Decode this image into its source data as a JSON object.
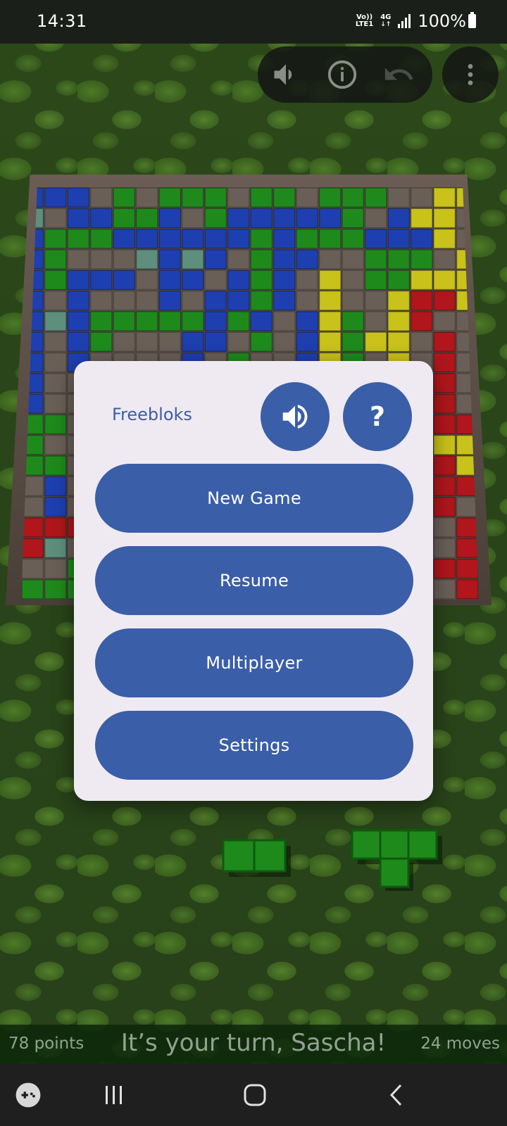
{
  "status_bar": {
    "time": "14:31",
    "network_top": "Vo))",
    "network_bottom": "LTE1",
    "data_type": "4G",
    "battery": "100%"
  },
  "toolbar": {
    "sound_icon": "speaker-icon",
    "info_icon": "info-icon",
    "undo_icon": "undo-icon",
    "menu_icon": "more-vertical-icon"
  },
  "dialog": {
    "title": "Freebloks",
    "sound_icon": "speaker-icon",
    "help_label": "?",
    "buttons": {
      "new_game": "New Game",
      "resume": "Resume",
      "multiplayer": "Multiplayer",
      "settings": "Settings"
    }
  },
  "game_status": {
    "points": "78 points",
    "turn_message": "It’s your turn, Sascha!",
    "moves": "24 moves"
  },
  "navigation": {
    "game_launcher_icon": "gamepad-icon",
    "recents_icon": "recents-icon",
    "home_icon": "home-icon",
    "back_icon": "back-icon"
  },
  "colors": {
    "player_blue": "#1e3fb0",
    "player_green": "#1f8a1c",
    "player_yellow": "#c9c21a",
    "player_red": "#b0161b",
    "dialog_button": "#3a5ea8",
    "dialog_background": "#efeaf1"
  }
}
